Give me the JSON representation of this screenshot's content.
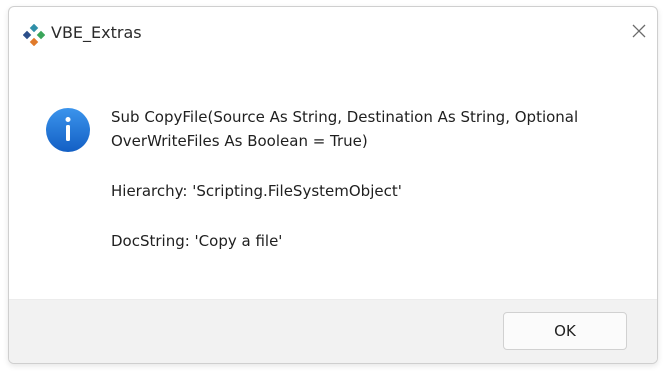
{
  "window": {
    "title": "VBE_Extras",
    "app_icon": "vbe-extras-diamond-icon",
    "close_icon": "close-icon"
  },
  "message": {
    "icon": "info-icon",
    "line1": "Sub CopyFile(Source As String, Destination As String, Optional",
    "line2": "OverWriteFiles As Boolean = True)",
    "hierarchy": "Hierarchy: 'Scripting.FileSystemObject'",
    "docstring": "DocString: 'Copy a file'"
  },
  "buttons": {
    "ok_label": "OK"
  },
  "colors": {
    "info_blue": "#1a73d9",
    "diamond_teal": "#2f8fa8",
    "diamond_green": "#3aa55a",
    "diamond_orange": "#e07a2a",
    "diamond_navy": "#2b4f8a",
    "footer_bg": "#f2f2f2"
  }
}
